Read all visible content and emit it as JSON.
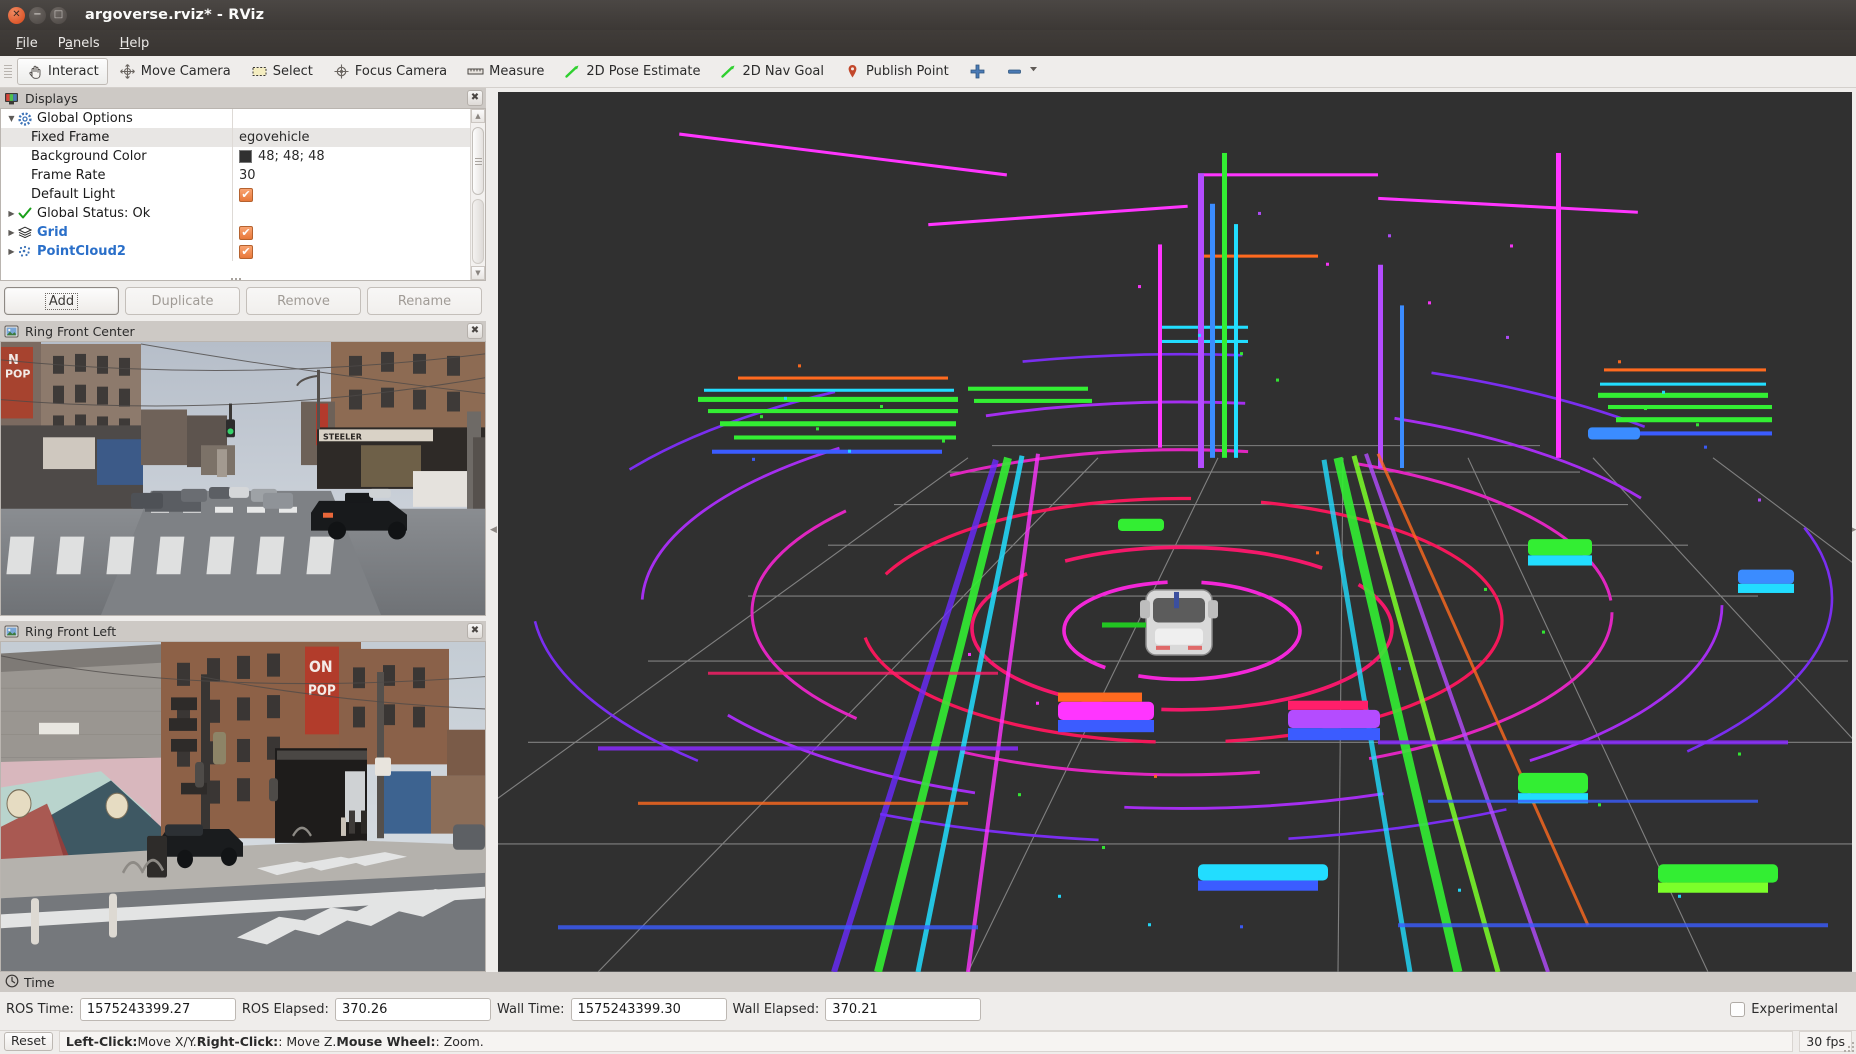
{
  "window": {
    "title": "argoverse.rviz* - RViz",
    "close_icon": "close-icon",
    "minimize_icon": "minimize-icon",
    "maximize_icon": "maximize-icon"
  },
  "menubar": {
    "items": [
      {
        "label": "File",
        "mnemonic": "F"
      },
      {
        "label": "Panels",
        "mnemonic": "P"
      },
      {
        "label": "Help",
        "mnemonic": "H"
      }
    ]
  },
  "toolbar": {
    "items": [
      {
        "label": "Interact",
        "icon": "hand-cursor-icon",
        "active": true
      },
      {
        "label": "Move Camera",
        "icon": "move-camera-icon",
        "active": false
      },
      {
        "label": "Select",
        "icon": "select-rectangle-icon",
        "active": false
      },
      {
        "label": "Focus Camera",
        "icon": "focus-camera-icon",
        "active": false
      },
      {
        "label": "Measure",
        "icon": "ruler-icon",
        "active": false
      },
      {
        "label": "2D Pose Estimate",
        "icon": "green-arrow-icon",
        "active": false
      },
      {
        "label": "2D Nav Goal",
        "icon": "green-arrow-icon",
        "active": false
      },
      {
        "label": "Publish Point",
        "icon": "map-pin-icon",
        "active": false
      }
    ],
    "add_tool_icon": "plus-icon",
    "remove_tool_icon": "minus-icon",
    "remove_tool_dropdown_icon": "chevron-down-icon"
  },
  "displays": {
    "title": "Displays",
    "title_icon": "displays-monitor-icon",
    "rows": [
      {
        "indent": 0,
        "arrow": "▼",
        "icon": "gear-icon",
        "label": "Global Options",
        "label_style": "plain",
        "value_type": "none",
        "value": "",
        "alt": false
      },
      {
        "indent": 1,
        "arrow": "",
        "icon": "",
        "label": "Fixed Frame",
        "label_style": "plain",
        "value_type": "text",
        "value": "egovehicle",
        "alt": true
      },
      {
        "indent": 1,
        "arrow": "",
        "icon": "",
        "label": "Background Color",
        "label_style": "plain",
        "value_type": "color",
        "value": "48; 48; 48",
        "color": "#303030",
        "alt": false
      },
      {
        "indent": 1,
        "arrow": "",
        "icon": "",
        "label": "Frame Rate",
        "label_style": "plain",
        "value_type": "text",
        "value": "30",
        "alt": false
      },
      {
        "indent": 1,
        "arrow": "",
        "icon": "",
        "label": "Default Light",
        "label_style": "plain",
        "value_type": "checkbox",
        "value": "✔",
        "alt": false
      },
      {
        "indent": 0,
        "arrow": "▶",
        "icon": "green-check-icon",
        "label": "Global Status: Ok",
        "label_style": "plain",
        "value_type": "none",
        "value": "",
        "alt": false
      },
      {
        "indent": 0,
        "arrow": "▶",
        "icon": "grid-layers-icon",
        "label": "Grid",
        "label_style": "blue",
        "value_type": "checkbox",
        "value": "✔",
        "alt": false
      },
      {
        "indent": 0,
        "arrow": "▶",
        "icon": "pointcloud-icon",
        "label": "PointCloud2",
        "label_style": "blue",
        "value_type": "checkbox",
        "value": "✔",
        "alt": false
      }
    ],
    "buttons": [
      {
        "label": "Add",
        "enabled": true,
        "focused": true
      },
      {
        "label": "Duplicate",
        "enabled": false,
        "focused": false
      },
      {
        "label": "Remove",
        "enabled": false,
        "focused": false
      },
      {
        "label": "Rename",
        "enabled": false,
        "focused": false
      }
    ]
  },
  "cameras": [
    {
      "title": "Ring Front Center",
      "title_icon": "image-panel-icon",
      "close_icon": "close-icon"
    },
    {
      "title": "Ring Front Left",
      "title_icon": "image-panel-icon",
      "close_icon": "close-icon"
    }
  ],
  "time": {
    "title": "Time",
    "title_icon": "clock-icon",
    "fields": [
      {
        "label": "ROS Time:",
        "value": "1575243399.27"
      },
      {
        "label": "ROS Elapsed:",
        "value": "370.26"
      },
      {
        "label": "Wall Time:",
        "value": "1575243399.30"
      },
      {
        "label": "Wall Elapsed:",
        "value": "370.21"
      }
    ],
    "experimental_label": "Experimental",
    "experimental_checked": false
  },
  "status": {
    "reset_label": "Reset",
    "hint_parts": [
      {
        "text": "Left-Click:",
        "bold": true
      },
      {
        "text": " Move X/Y. ",
        "bold": false
      },
      {
        "text": "Right-Click:",
        "bold": true
      },
      {
        "text": ": Move Z. ",
        "bold": false
      },
      {
        "text": "Mouse Wheel:",
        "bold": true
      },
      {
        "text": ": Zoom.",
        "bold": false
      }
    ],
    "fps": "30 fps"
  },
  "view3d": {
    "background_color": "#303030",
    "grid_color": "#9a9a9a",
    "ego_vehicle_color": "#e6e6e6",
    "ego_axis_color": "#20c020",
    "description": "LiDAR point cloud of an urban street intersection colored by height, with ego vehicle model at center"
  },
  "colors": {
    "titlebar": "#3c3835",
    "panel_header": "#cdc9c5",
    "accent_checkbox": "#e8783a",
    "tree_link": "#2a6fc9",
    "toolbar_bg": "#efedeb"
  }
}
